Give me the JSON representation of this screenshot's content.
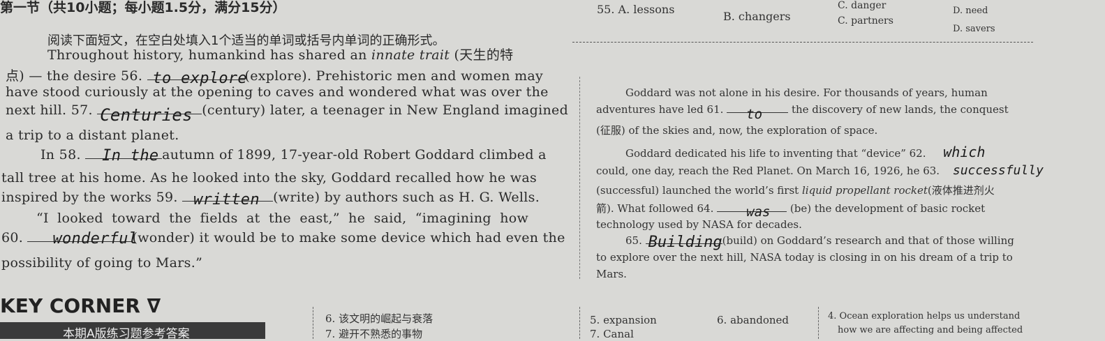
{
  "header": {
    "section_title": "第一节（共10小题；每小题1.5分，满分15分）",
    "instruction": "阅读下面短文，在空白处填入1个适当的单词或括号内单词的正确形式。",
    "options": [
      "55. A. lessons",
      "B. changers",
      "C. danger",
      "C. partners",
      "D. need",
      "D. savers"
    ]
  },
  "left": {
    "line1": "Throughout history, humankind has shared an",
    "line1_italic": "innate trait",
    "line1_tail": "(天生的特",
    "line2_pre": "点) — the desire 56.",
    "ans56": "to explore",
    "line2_post": "(explore). Prehistoric men and women may",
    "line3": "have stood curiously at the opening to caves and wondered what was over the",
    "line4_pre": "next hill. 57.",
    "ans57": "Centuries",
    "line4_post": "(century) later, a teenager in New England imagined",
    "line5": "a trip to a distant planet.",
    "line6_pre": "In 58.",
    "ans58": "In the",
    "line6_post": "autumn of 1899, 17-year-old Robert Goddard climbed a",
    "line7": "tall tree at his home. As he looked into the sky, Goddard recalled how he was",
    "line8_pre": "inspired by the works 59.",
    "ans59": "written",
    "line8_post": "(write) by authors such as H. G. Wells.",
    "line9": "“I looked toward the fields at the east,” he said, “imagining how",
    "line10_pre": "60.",
    "ans60": "wonderful",
    "line10_post": "(wonder) it would be to make some device which had even the",
    "line11": "possibility of going to Mars.”"
  },
  "right": {
    "r1": "Goddard was not alone in his desire. For thousands of years, human",
    "r2_pre": "adventures have led 61.",
    "ans61": "to",
    "r2_post": "the discovery of new lands, the conquest",
    "r3": "(征服) of the skies and, now, the exploration of space.",
    "r4_pre": "Goddard dedicated his life to inventing that “device” 62.",
    "ans62": "which",
    "r5_pre": "could, one day, reach the Red Planet. On March 16, 1926, he 63.",
    "ans63": "successfully",
    "r6_pre": "(successful) launched the world’s first",
    "r6_italic": "liquid propellant rocket",
    "r6_post": "(液体推进剂火",
    "r7_pre": "箭). What followed 64.",
    "ans64": "was",
    "r7_post": "(be) the development of basic rocket",
    "r8": "technology used by NASA for decades.",
    "r9_pre": "65.",
    "ans65": "Building",
    "r9_post": "(build) on Goddard’s research and that of those willing",
    "r10": "to explore over the next hill, NASA today is closing in on his dream of a trip to",
    "r11": "Mars."
  },
  "footer": {
    "key_corner": "KEY CORNER ∇",
    "banner": "本期A版练习题参考答案",
    "c1a": "6. 该文明的崛起与衰落",
    "c1b": "7. 避开不熟悉的事物",
    "c2a": "5. expansion",
    "c2b": "7. Canal",
    "c3": "6. abandoned",
    "c4a": "4. Ocean exploration helps us understand",
    "c4b": "how we are affecting and being affected"
  }
}
